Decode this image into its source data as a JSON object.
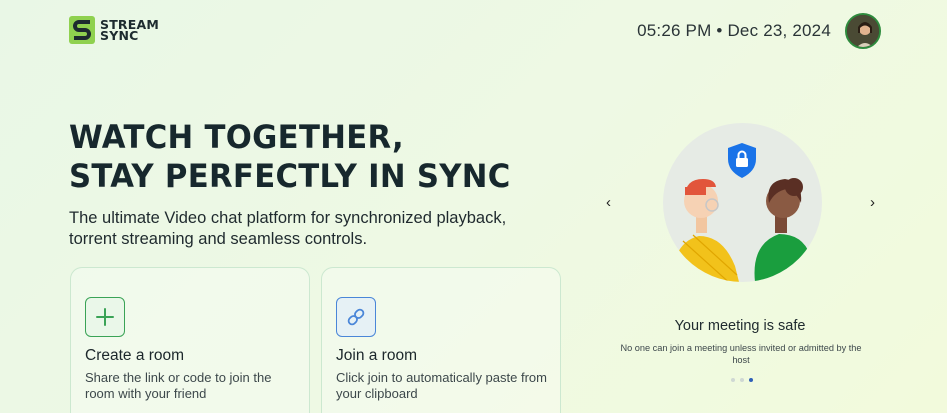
{
  "header": {
    "logo_line1": "STREAM",
    "logo_line2": "SYNC",
    "datetime": "05:26 PM • Dec 23, 2024",
    "avatar_icon": "user-avatar"
  },
  "hero": {
    "title_line1": "WATCH TOGETHER,",
    "title_line2": "STAY PERFECTLY IN SYNC",
    "subtitle": "The ultimate Video chat platform for synchronized playback, torrent streaming and seamless controls."
  },
  "cards": [
    {
      "icon": "plus-icon",
      "title": "Create a room",
      "description": "Share the link or code to join the room with your friend",
      "accent": "#3aa356"
    },
    {
      "icon": "link-icon",
      "title": "Join a room",
      "description": "Click join to automatically paste from your clipboard",
      "accent": "#4a86d8"
    }
  ],
  "carousel": {
    "prev_icon": "chevron-left-icon",
    "next_icon": "chevron-right-icon",
    "prev_glyph": "‹",
    "next_glyph": "›",
    "slide_title": "Your meeting is safe",
    "slide_description": "No one can join a meeting unless invited or admitted by the host",
    "slide_count": 3,
    "active_slide": 3
  },
  "colors": {
    "brand_green": "#2e8b3d",
    "logo_green": "#8fd14f",
    "active_dot": "#2e5fb8",
    "shield_blue": "#1a73e8"
  }
}
